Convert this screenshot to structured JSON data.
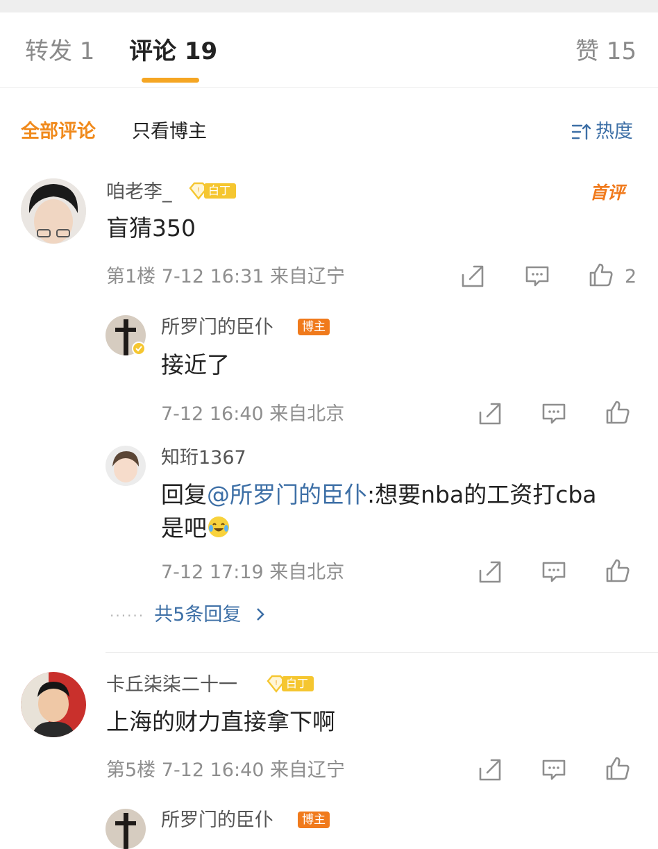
{
  "tabs": {
    "repost": "转发 1",
    "comments": "评论 19",
    "likes": "赞 15"
  },
  "filters": {
    "all": "全部评论",
    "host_only": "只看博主",
    "sort": "热度"
  },
  "comments": [
    {
      "user": "咱老李_",
      "badge": "白丁",
      "first_label": "首评",
      "text": "盲猜350",
      "meta": "第1楼  7-12 16:31  来自辽宁",
      "likes": "2",
      "replies": [
        {
          "user": "所罗门的臣仆",
          "badge": "博主",
          "text": "接近了",
          "meta": "7-12 16:40  来自北京"
        },
        {
          "user": "知珩1367",
          "text_prefix": "回复",
          "mention": "@所罗门的臣仆",
          "text_rest": ":想要nba的工资打cba",
          "text_line2": "是吧",
          "emoji": "laugh-cry-emoji",
          "meta": "7-12 17:19  来自北京"
        }
      ],
      "more_replies": "共5条回复"
    },
    {
      "user": "卡丘柒柒二十一",
      "badge": "白丁",
      "text": "上海的财力直接拿下啊",
      "meta": "第5楼  7-12 16:40  来自辽宁",
      "replies": [
        {
          "user": "所罗门的臣仆",
          "badge": "博主"
        }
      ]
    }
  ],
  "colors": {
    "accent": "#f5a623",
    "link": "#3d6fa6",
    "host_badge": "#f07a1c",
    "gold_badge": "#f5c630"
  }
}
